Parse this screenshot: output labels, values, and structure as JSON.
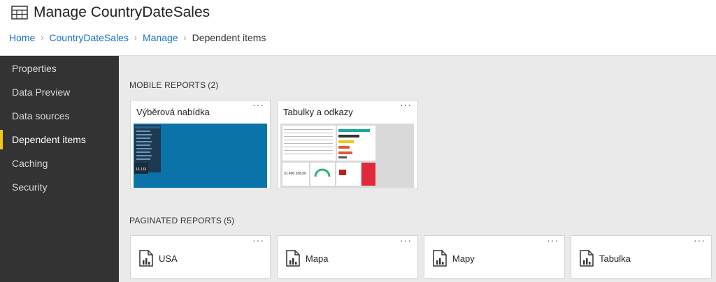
{
  "header": {
    "title": "Manage CountryDateSales",
    "title_icon": "table-icon"
  },
  "breadcrumb": {
    "items": [
      "Home",
      "CountryDateSales",
      "Manage"
    ],
    "current": "Dependent items"
  },
  "sidebar": {
    "items": [
      {
        "label": "Properties"
      },
      {
        "label": "Data Preview"
      },
      {
        "label": "Data sources"
      },
      {
        "label": "Dependent items"
      },
      {
        "label": "Caching"
      },
      {
        "label": "Security"
      }
    ],
    "active": "Dependent items",
    "accent_color": "#f2c811"
  },
  "mobile_reports": {
    "label": "MOBILE REPORTS",
    "count": "(2)",
    "items": [
      {
        "title": "Výběrová nabídka",
        "menu": "···",
        "thumb_value": "16 133"
      },
      {
        "title": "Tabulky a odkazy",
        "menu": "···",
        "thumb_value": "31 490 208,00"
      }
    ]
  },
  "paginated_reports": {
    "label": "PAGINATED REPORTS",
    "count": "(5)",
    "items": [
      {
        "title": "USA",
        "menu": "···"
      },
      {
        "title": "Mapa",
        "menu": "···"
      },
      {
        "title": "Mapy",
        "menu": "···"
      },
      {
        "title": "Tabulka",
        "menu": "···"
      }
    ]
  },
  "colors": {
    "link": "#1a6fc9",
    "sidebar_bg": "#333333",
    "main_bg": "#eaeaea",
    "thumb_blue": "#0a74a8"
  }
}
